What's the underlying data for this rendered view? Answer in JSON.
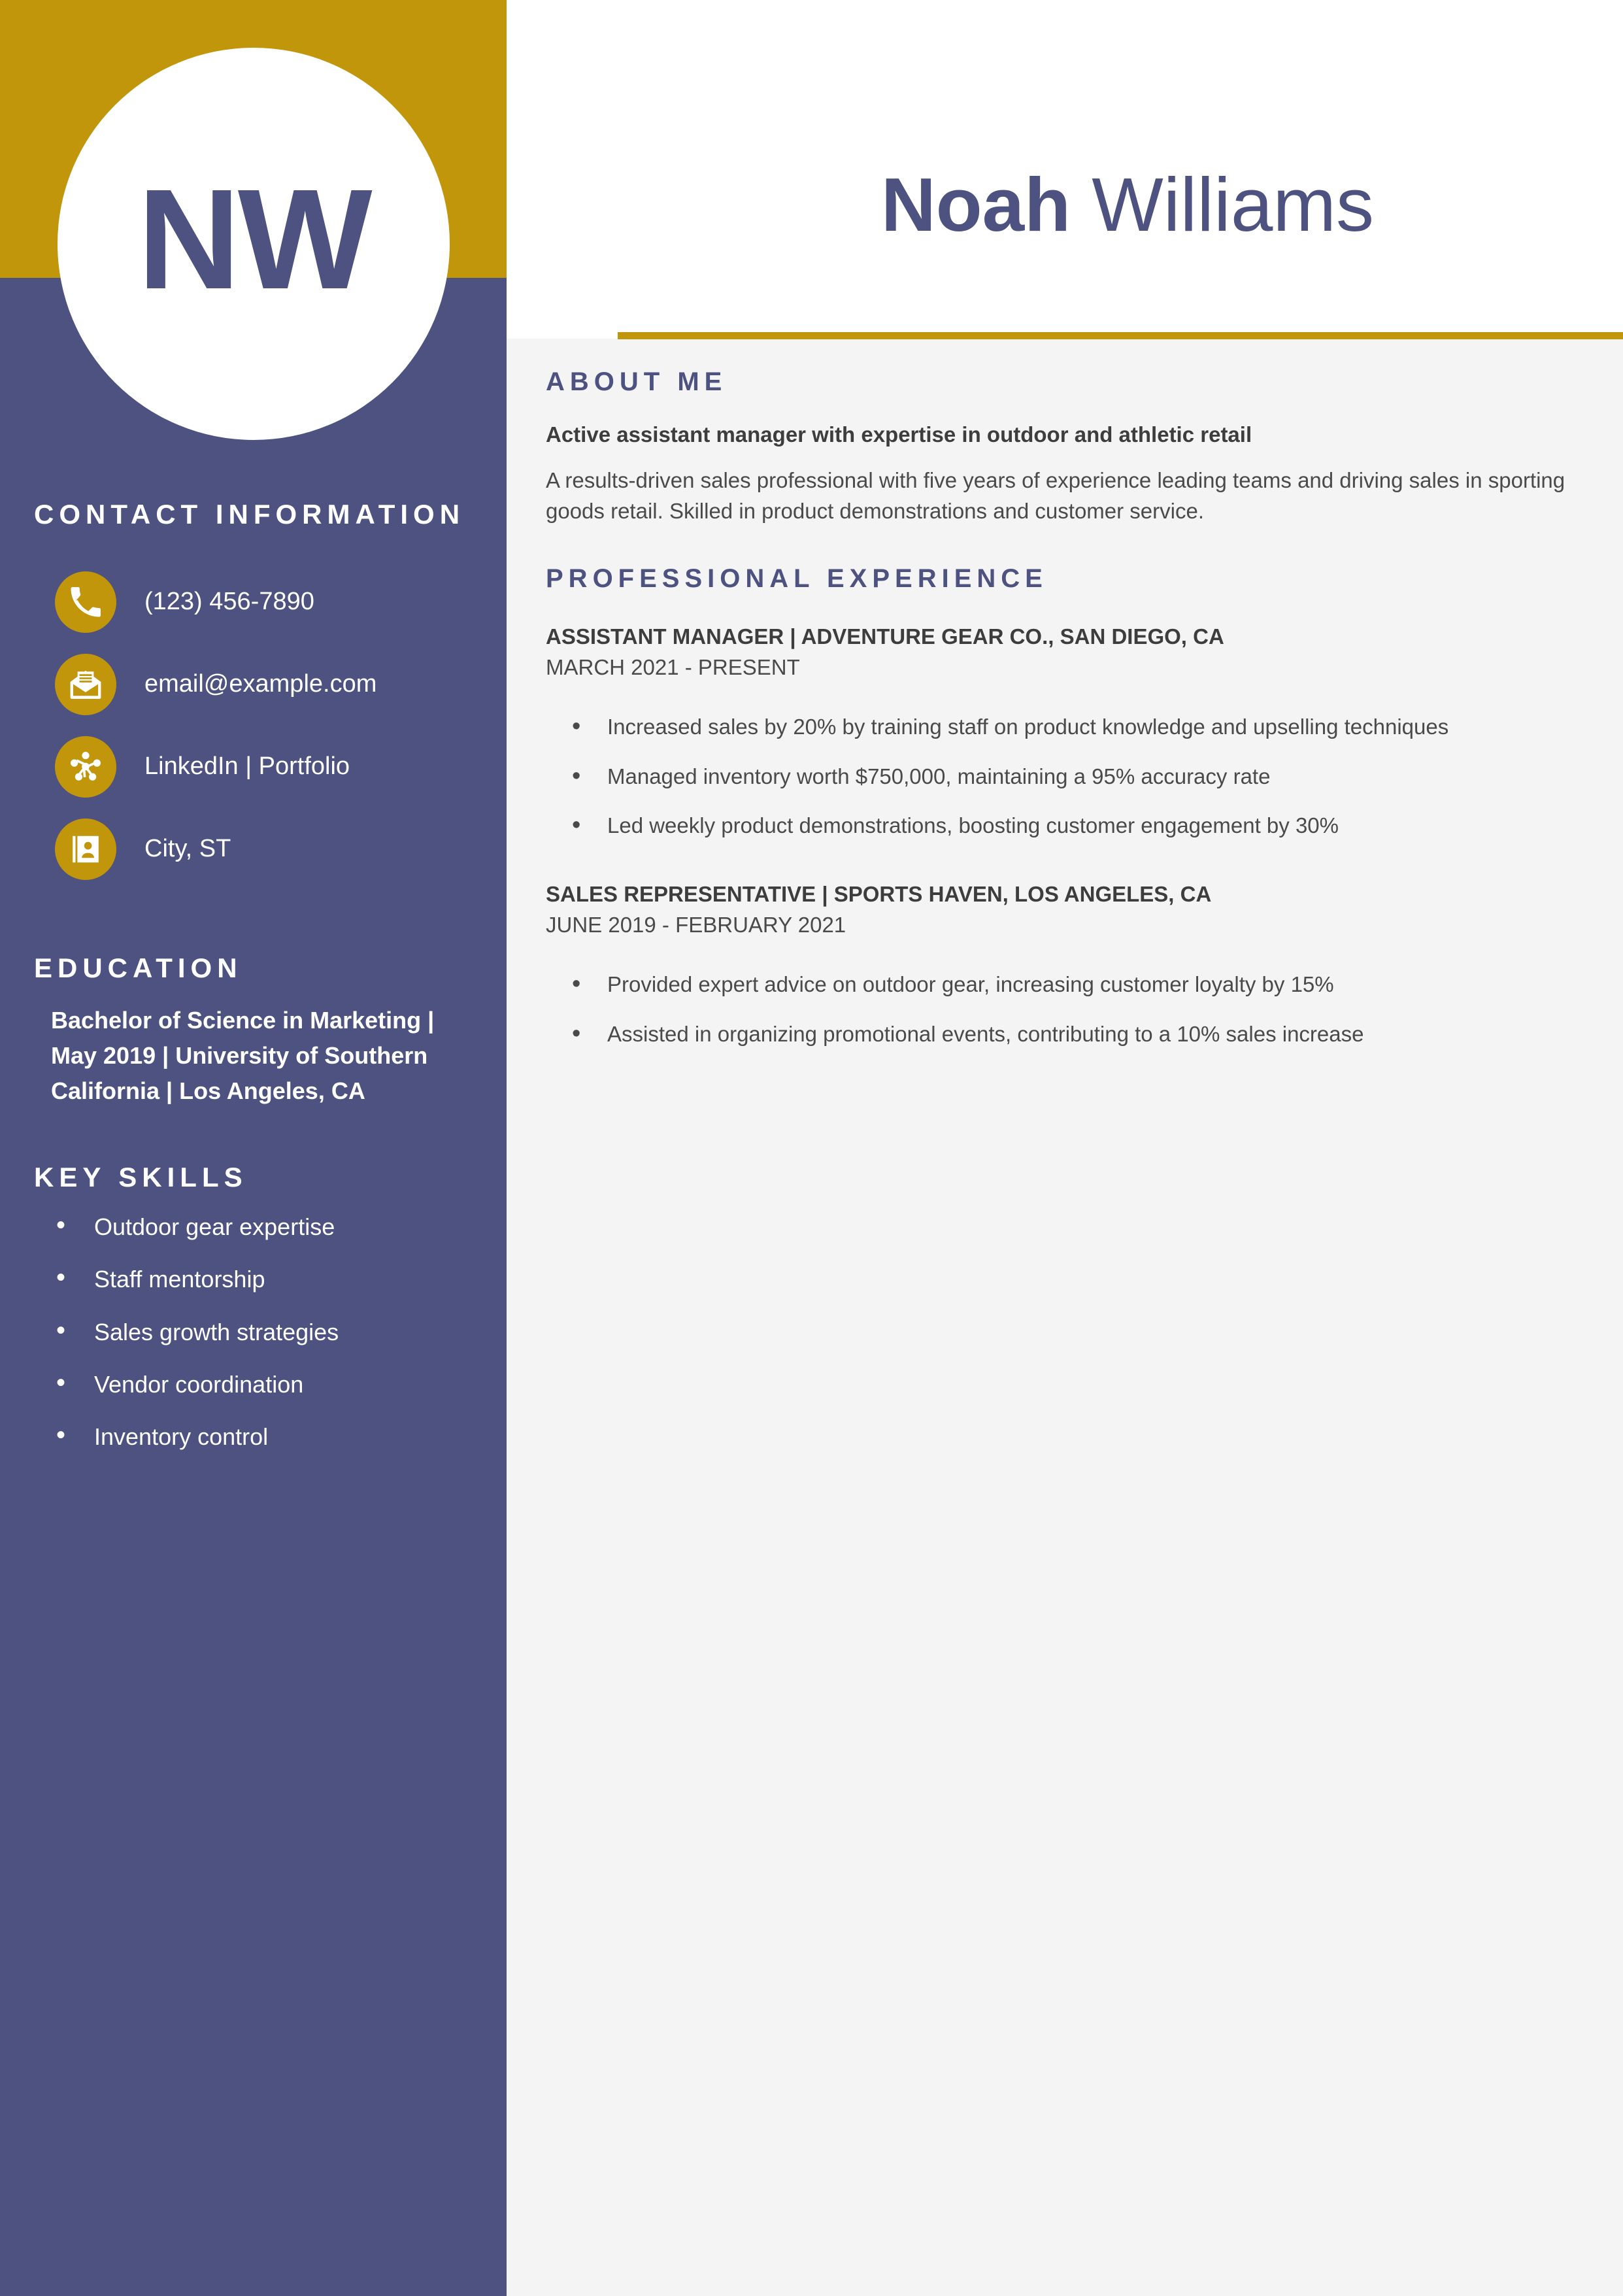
{
  "theme": {
    "navy": "#4d5280",
    "gold": "#c1960a",
    "page_bg": "#f4f4f4",
    "body_text": "#4a4a4a"
  },
  "header": {
    "initials": "NW",
    "first_name": "Noah",
    "last_name": "Williams"
  },
  "sidebar": {
    "contact_heading": "CONTACT INFORMATION",
    "contact_items": [
      {
        "icon": "phone-icon",
        "text": "(123) 456-7890"
      },
      {
        "icon": "envelope-icon",
        "text": "email@example.com"
      },
      {
        "icon": "network-icon",
        "text": "LinkedIn | Portfolio"
      },
      {
        "icon": "address-book-icon",
        "text": "City, ST"
      }
    ],
    "education_heading": "EDUCATION",
    "education_text": "Bachelor of Science in Marketing | May 2019 | University of Southern California | Los Angeles, CA",
    "skills_heading": "KEY SKILLS",
    "skills": [
      "Outdoor gear expertise",
      "Staff mentorship",
      "Sales growth strategies",
      "Vendor coordination",
      "Inventory control"
    ]
  },
  "main": {
    "about_heading": "ABOUT ME",
    "tagline": "Active assistant manager with expertise in outdoor and athletic retail",
    "summary": "A results-driven sales professional with five years of experience leading teams and driving sales in sporting goods retail. Skilled in product demonstrations and customer service.",
    "experience_heading": "PROFESSIONAL EXPERIENCE",
    "jobs": [
      {
        "title": "ASSISTANT MANAGER | ADVENTURE GEAR CO., SAN DIEGO, CA",
        "dates": "MARCH 2021 - PRESENT",
        "points": [
          "Increased sales by 20% by training staff on product knowledge and upselling techniques",
          "Managed inventory worth $750,000, maintaining a 95% accuracy rate",
          "Led weekly product demonstrations, boosting customer engagement by 30%"
        ]
      },
      {
        "title": "SALES REPRESENTATIVE | SPORTS HAVEN, LOS ANGELES, CA",
        "dates": "JUNE 2019 - FEBRUARY 2021",
        "points": [
          "Provided expert advice on outdoor gear, increasing customer loyalty by 15%",
          "Assisted in organizing promotional events, contributing to a 10% sales increase"
        ]
      }
    ]
  }
}
